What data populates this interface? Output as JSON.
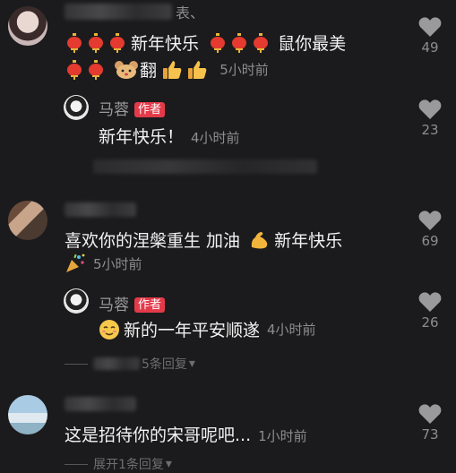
{
  "comments": [
    {
      "text_a": "新年快乐",
      "text_b": "鼠你最美",
      "text_c": "翻",
      "time": "5小时前",
      "likes": "49",
      "blurred_name_suffix": "表、",
      "reply": {
        "name": "马蓉",
        "tag": "作者",
        "text": "新年快乐！",
        "time": "4小时前",
        "likes": "23"
      }
    },
    {
      "text_a": "喜欢你的涅槃重生 加油",
      "text_b": "新年快乐",
      "time": "5小时前",
      "likes": "69",
      "reply": {
        "name": "马蓉",
        "tag": "作者",
        "text": "新的一年平安顺遂",
        "time": "4小时前",
        "likes": "26"
      },
      "expand_text": "5条回复"
    },
    {
      "text": "这是招待你的宋哥呢吧...",
      "time": "1小时前",
      "likes": "73",
      "expand_text": "展开1条回复"
    }
  ],
  "icons": {
    "heart": "heart-icon",
    "lantern": "red-lantern-emoji",
    "mouse": "mouse-face-emoji",
    "thumbs": "thumbs-up-emoji",
    "muscle": "flexed-biceps-emoji",
    "party": "party-popper-emoji",
    "smile": "relieved-face-emoji",
    "chevron": "chevron-down-icon"
  },
  "colors": {
    "background": "#1b1b1d",
    "author_tag": "#e33a4a",
    "muted": "#8d8d90"
  }
}
